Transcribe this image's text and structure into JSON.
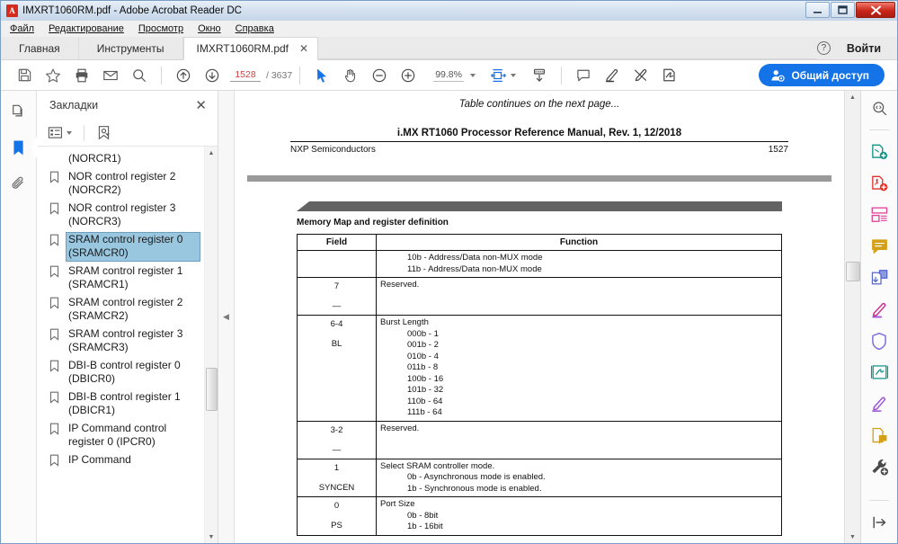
{
  "window": {
    "title": "IMXRT1060RM.pdf - Adobe Acrobat Reader DC",
    "app_icon": "pdf-icon",
    "minimize": "–",
    "maximize": "❑",
    "close": "✕"
  },
  "menubar": {
    "items": [
      {
        "label": "Файл",
        "name": "menu-file"
      },
      {
        "label": "Редактирование",
        "name": "menu-edit"
      },
      {
        "label": "Просмотр",
        "name": "menu-view"
      },
      {
        "label": "Окно",
        "name": "menu-window"
      },
      {
        "label": "Справка",
        "name": "menu-help"
      }
    ]
  },
  "tabs": {
    "home": "Главная",
    "tools": "Инструменты",
    "document": "IMXRT1060RM.pdf",
    "document_close": "✕",
    "help_icon": "?",
    "signin": "Войти"
  },
  "toolbar": {
    "save_icon": "save-icon",
    "star_icon": "star-icon",
    "print_icon": "print-icon",
    "email_icon": "email-icon",
    "search_icon": "search-icon",
    "prev_page_icon": "arrow-up-circle-icon",
    "next_page_icon": "arrow-down-circle-icon",
    "page_current": "1528",
    "page_total": "/ 3637",
    "select_icon": "cursor-arrow-icon",
    "hand_icon": "hand-icon",
    "zoom_out_icon": "minus-circle-icon",
    "zoom_in_icon": "plus-circle-icon",
    "zoom_value": "99.8%",
    "fit_icon": "fit-page-icon",
    "scroll_mode_icon": "scroll-mode-icon",
    "comment_icon": "comment-icon",
    "highlight_icon": "highlight-icon",
    "erase_highlight_icon": "highlight-erase-icon",
    "sign_icon": "sign-icon",
    "share_label": "Общий доступ",
    "share_icon": "share-person-icon",
    "share_color": "#1473e6"
  },
  "left_rail": {
    "items": [
      {
        "name": "page-thumbnails-icon",
        "label": "pages-icon",
        "active": false
      },
      {
        "name": "bookmarks-icon",
        "label": "bookmark-icon",
        "active": true
      },
      {
        "name": "attachments-icon",
        "label": "paperclip-icon",
        "active": false
      }
    ]
  },
  "bookmarks_panel": {
    "title": "Закладки",
    "close_label": "✕",
    "options_icon": "list-options-icon",
    "options_caret": "▾",
    "new_bookmark_icon": "new-bookmark-icon",
    "items": [
      {
        "label": "(NORCR1)",
        "selected": false,
        "continuation": true,
        "icon": "bookmark-icon"
      },
      {
        "label": "NOR control register 2 (NORCR2)",
        "selected": false,
        "continuation": false,
        "icon": "bookmark-icon"
      },
      {
        "label": "NOR control register 3 (NORCR3)",
        "selected": false,
        "continuation": false,
        "icon": "bookmark-icon"
      },
      {
        "label": "SRAM control register 0 (SRAMCR0)",
        "selected": true,
        "continuation": false,
        "icon": "bookmark-icon"
      },
      {
        "label": "SRAM control register 1 (SRAMCR1)",
        "selected": false,
        "continuation": false,
        "icon": "bookmark-icon"
      },
      {
        "label": "SRAM control register 2 (SRAMCR2)",
        "selected": false,
        "continuation": false,
        "icon": "bookmark-icon"
      },
      {
        "label": "SRAM control register 3 (SRAMCR3)",
        "selected": false,
        "continuation": false,
        "icon": "bookmark-icon"
      },
      {
        "label": "DBI-B control register 0 (DBICR0)",
        "selected": false,
        "continuation": false,
        "icon": "bookmark-icon"
      },
      {
        "label": "DBI-B control register 1 (DBICR1)",
        "selected": false,
        "continuation": false,
        "icon": "bookmark-icon"
      },
      {
        "label": "IP Command control register 0 (IPCR0)",
        "selected": false,
        "continuation": false,
        "icon": "bookmark-icon"
      },
      {
        "label": "IP Command",
        "selected": false,
        "continuation": false,
        "icon": "bookmark-icon"
      }
    ],
    "scroll_up": "▲",
    "scroll_down": "▼"
  },
  "splitter": {
    "collapse_icon": "◀"
  },
  "document": {
    "table_continues": "Table continues on the next page...",
    "page_header": "i.MX RT1060 Processor Reference Manual, Rev. 1, 12/2018",
    "footer_left": "NXP Semiconductors",
    "footer_right": "1527",
    "section_label": "Memory Map and register definition",
    "table": {
      "headers": [
        "Field",
        "Function"
      ],
      "rows": [
        {
          "field": "",
          "field_sub": "",
          "function_title": "",
          "function_lines": [
            "10b - Address/Data non-MUX mode",
            "11b - Address/Data non-MUX mode"
          ],
          "indent": true
        },
        {
          "field": "7",
          "field_sub": "—",
          "function_title": "Reserved.",
          "function_lines": [],
          "indent": false
        },
        {
          "field": "6-4",
          "field_sub": "BL",
          "function_title": "Burst Length",
          "function_lines": [
            "000b - 1",
            "001b - 2",
            "010b - 4",
            "011b - 8",
            "100b - 16",
            "101b - 32",
            "110b - 64",
            "111b - 64"
          ],
          "indent": true
        },
        {
          "field": "3-2",
          "field_sub": "—",
          "function_title": "Reserved.",
          "function_lines": [],
          "indent": false
        },
        {
          "field": "1",
          "field_sub": "SYNCEN",
          "function_title": "Select SRAM controller mode.",
          "function_lines": [
            "0b - Asynchronous mode is enabled.",
            "1b - Synchronous mode is enabled."
          ],
          "indent": true
        },
        {
          "field": "0",
          "field_sub": "PS",
          "function_title": "Port Size",
          "function_lines": [
            "0b - 8bit",
            "1b - 16bit"
          ],
          "indent": true
        }
      ]
    },
    "scroll_up": "▲",
    "scroll_down": "▼"
  },
  "right_tools": {
    "items": [
      {
        "name": "search-tool-icon",
        "color": "#5a5a5a"
      },
      {
        "name": "export-pdf-icon",
        "color": "#0d9488"
      },
      {
        "name": "create-pdf-icon",
        "color": "#e0322a"
      },
      {
        "name": "organize-pages-icon",
        "color": "#e0459a"
      },
      {
        "name": "comment-tool-icon",
        "color": "#d4a017"
      },
      {
        "name": "combine-files-icon",
        "color": "#5566cc"
      },
      {
        "name": "edit-pdf-icon",
        "color": "#cc2b8f"
      },
      {
        "name": "protect-icon",
        "color": "#7b68d9"
      },
      {
        "name": "adobe-sign-icon",
        "color": "#0d9488"
      },
      {
        "name": "fill-and-sign-icon",
        "color": "#9b4fd9"
      },
      {
        "name": "stamp-icon",
        "color": "#d4a017"
      },
      {
        "name": "more-tools-icon",
        "color": "#4a4a4a"
      },
      {
        "name": "collapse-panel-icon",
        "color": "#4a4a4a"
      }
    ]
  }
}
